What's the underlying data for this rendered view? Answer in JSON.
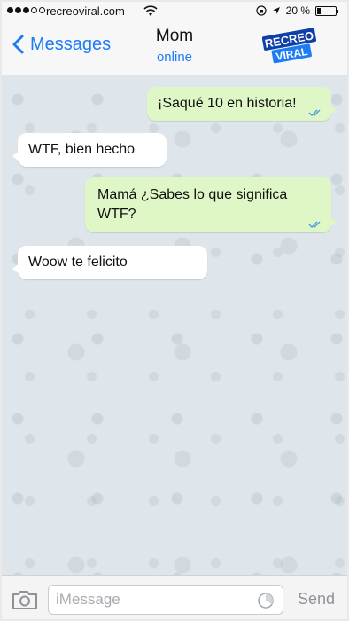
{
  "status_bar": {
    "carrier": "recreoviral.com",
    "battery_percent": "20 %",
    "battery_level": 0.2,
    "signal_bars_filled": 3,
    "signal_bars_total": 5
  },
  "nav": {
    "back_label": "Messages",
    "contact_name": "Mom",
    "contact_status": "online",
    "logo_line1": "RECREO",
    "logo_line2": "VIRAL"
  },
  "messages": [
    {
      "direction": "outgoing",
      "text": "¡Saqué 10 en historia!",
      "read": true
    },
    {
      "direction": "incoming",
      "text": "WTF, bien hecho"
    },
    {
      "direction": "outgoing",
      "text": "Mamá ¿Sabes lo que significa WTF?",
      "read": true
    },
    {
      "direction": "incoming",
      "text": "Woow te felicito"
    }
  ],
  "input_bar": {
    "placeholder": "iMessage",
    "value": "",
    "send_label": "Send"
  },
  "colors": {
    "accent": "#1b7cf3",
    "outgoing_bubble": "#dff7c6",
    "incoming_bubble": "#ffffff",
    "chat_background": "#dfe6eb"
  },
  "icons": [
    "back-chevron-icon",
    "wifi-icon",
    "lock-rotation-icon",
    "location-arrow-icon",
    "battery-icon",
    "camera-icon",
    "clock-icon",
    "double-check-icon"
  ]
}
